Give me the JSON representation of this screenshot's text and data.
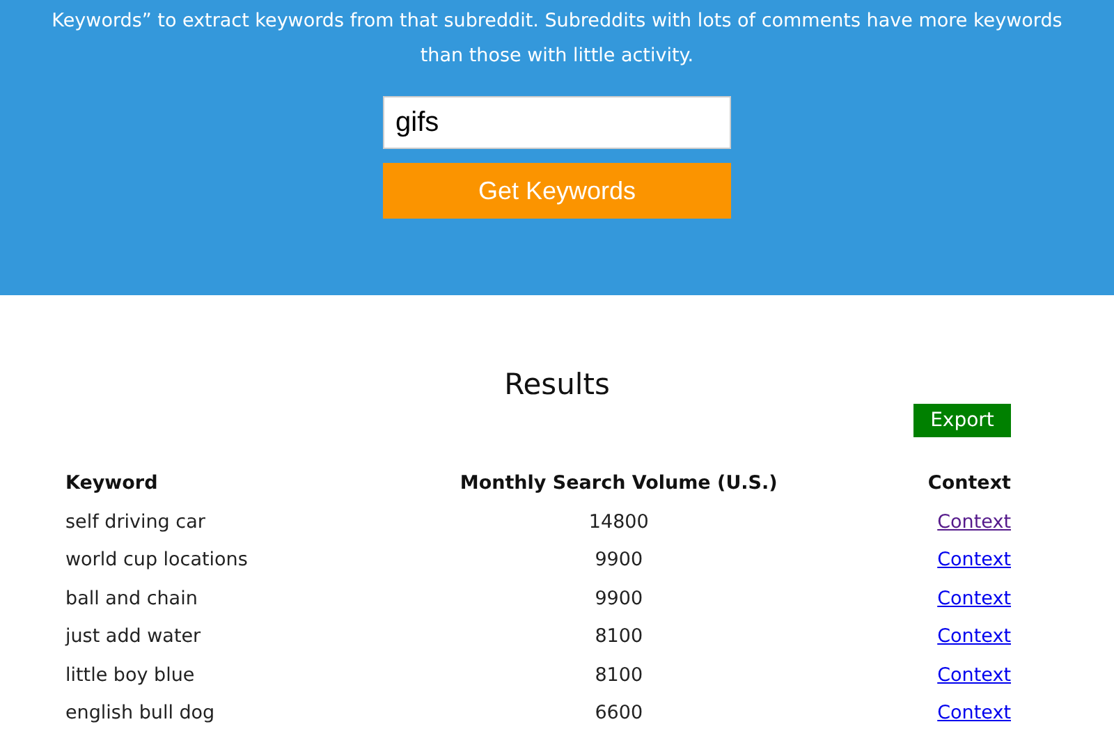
{
  "intro": {
    "lines": [
      "Keywords” to extract keywords from that subreddit. Subreddits with lots of comments have more keywords",
      "than those with little activity."
    ]
  },
  "search": {
    "value": "gifs",
    "button": "Get Keywords"
  },
  "results": {
    "title": "Results",
    "export_button": "Export",
    "columns": [
      "Keyword",
      "Monthly Search Volume (U.S.)",
      "Context"
    ],
    "rows": [
      {
        "keyword": "self driving car",
        "volume": "14800",
        "link": "Context",
        "visited": true
      },
      {
        "keyword": "world cup locations",
        "volume": "9900",
        "link": "Context",
        "visited": false
      },
      {
        "keyword": "ball and chain",
        "volume": "9900",
        "link": "Context",
        "visited": false
      },
      {
        "keyword": "just add water",
        "volume": "8100",
        "link": "Context",
        "visited": false
      },
      {
        "keyword": "little boy blue",
        "volume": "8100",
        "link": "Context",
        "visited": false
      },
      {
        "keyword": "english bull dog",
        "volume": "6600",
        "link": "Context",
        "visited": false
      }
    ]
  }
}
